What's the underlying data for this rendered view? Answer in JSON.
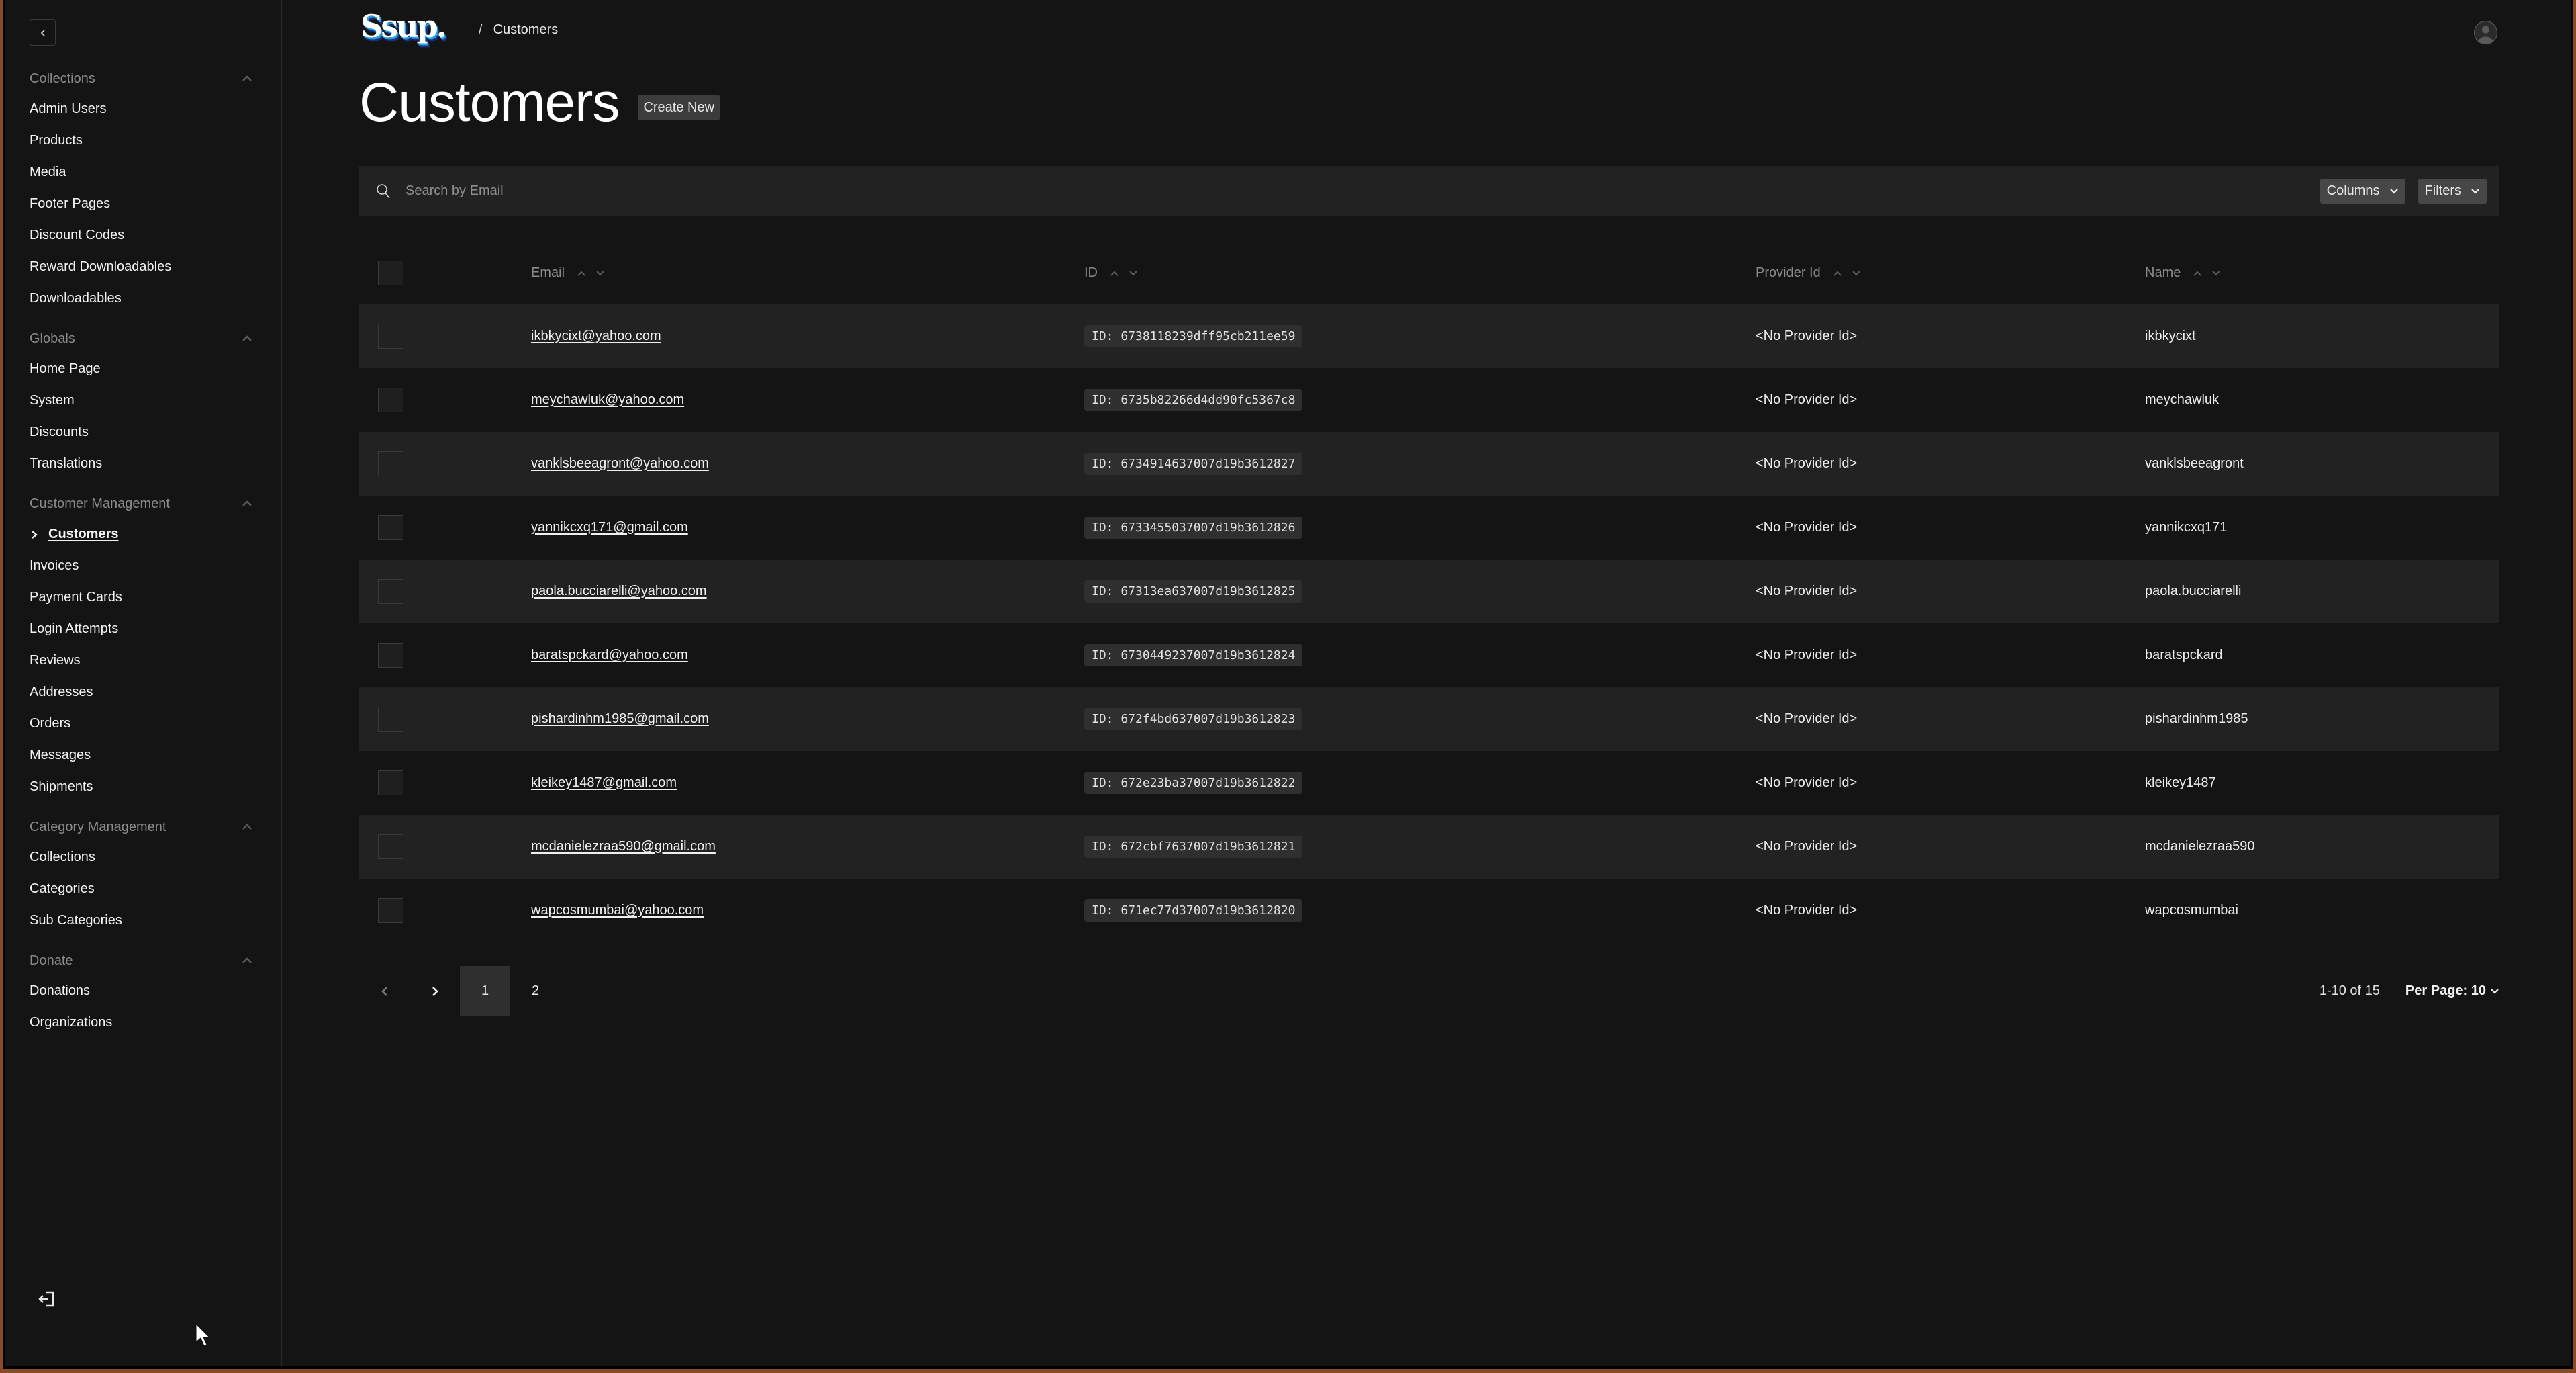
{
  "sidebar": {
    "collapse_label": "Collapse sidebar",
    "groups": [
      {
        "label": "Collections",
        "items": [
          "Admin Users",
          "Products",
          "Media",
          "Footer Pages",
          "Discount Codes",
          "Reward Downloadables",
          "Downloadables"
        ]
      },
      {
        "label": "Globals",
        "items": [
          "Home Page",
          "System",
          "Discounts",
          "Translations"
        ]
      },
      {
        "label": "Customer Management",
        "items": [
          "Customers",
          "Invoices",
          "Payment Cards",
          "Login Attempts",
          "Reviews",
          "Addresses",
          "Orders",
          "Messages",
          "Shipments"
        ],
        "active": "Customers"
      },
      {
        "label": "Category Management",
        "items": [
          "Collections",
          "Categories",
          "Sub Categories"
        ]
      },
      {
        "label": "Donate",
        "items": [
          "Donations",
          "Organizations"
        ]
      }
    ]
  },
  "header": {
    "logo_text": "Ssup.",
    "breadcrumb_separator": "/",
    "breadcrumb_current": "Customers"
  },
  "page": {
    "title": "Customers",
    "create_new_label": "Create New"
  },
  "toolbar": {
    "search_placeholder": "Search by Email",
    "search_value": "",
    "columns_label": "Columns",
    "filters_label": "Filters"
  },
  "table": {
    "columns": [
      "Email",
      "ID",
      "Provider Id",
      "Name"
    ],
    "rows": [
      {
        "email": "ikbkycixt@yahoo.com",
        "id": "ID: 6738118239dff95cb211ee59",
        "provider_id": "<No Provider Id>",
        "name": "ikbkycixt"
      },
      {
        "email": "meychawluk@yahoo.com",
        "id": "ID: 6735b82266d4dd90fc5367c8",
        "provider_id": "<No Provider Id>",
        "name": "meychawluk"
      },
      {
        "email": "vanklsbeeagront@yahoo.com",
        "id": "ID: 6734914637007d19b3612827",
        "provider_id": "<No Provider Id>",
        "name": "vanklsbeeagront"
      },
      {
        "email": "yannikcxq171@gmail.com",
        "id": "ID: 6733455037007d19b3612826",
        "provider_id": "<No Provider Id>",
        "name": "yannikcxq171"
      },
      {
        "email": "paola.bucciarelli@yahoo.com",
        "id": "ID: 67313ea637007d19b3612825",
        "provider_id": "<No Provider Id>",
        "name": "paola.bucciarelli"
      },
      {
        "email": "baratspckard@yahoo.com",
        "id": "ID: 6730449237007d19b3612824",
        "provider_id": "<No Provider Id>",
        "name": "baratspckard"
      },
      {
        "email": "pishardinhm1985@gmail.com",
        "id": "ID: 672f4bd637007d19b3612823",
        "provider_id": "<No Provider Id>",
        "name": "pishardinhm1985"
      },
      {
        "email": "kleikey1487@gmail.com",
        "id": "ID: 672e23ba37007d19b3612822",
        "provider_id": "<No Provider Id>",
        "name": "kleikey1487"
      },
      {
        "email": "mcdanielezraa590@gmail.com",
        "id": "ID: 672cbf7637007d19b3612821",
        "provider_id": "<No Provider Id>",
        "name": "mcdanielezraa590"
      },
      {
        "email": "wapcosmumbai@yahoo.com",
        "id": "ID: 671ec77d37007d19b3612820",
        "provider_id": "<No Provider Id>",
        "name": "wapcosmumbai"
      }
    ]
  },
  "pagination": {
    "pages": [
      "1",
      "2"
    ],
    "current_page": "1",
    "range_text": "1-10 of 15",
    "per_page_label": "Per Page: 10"
  },
  "colors": {
    "background": "#141414",
    "row_alt": "#222222",
    "pill": "#2f2f2f",
    "button": "#3c3c3c",
    "muted_text": "#8a8a8a",
    "frame": "#8a4a26"
  }
}
